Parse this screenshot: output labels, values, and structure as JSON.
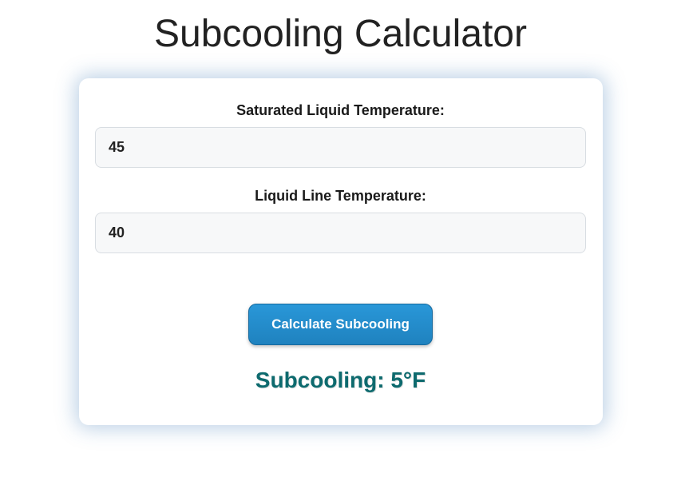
{
  "title": "Subcooling Calculator",
  "fields": {
    "sat_liquid": {
      "label": "Saturated Liquid Temperature:",
      "value": "45"
    },
    "liquid_line": {
      "label": "Liquid Line Temperature:",
      "value": "40"
    }
  },
  "button": {
    "calculate_label": "Calculate Subcooling"
  },
  "result": {
    "text": "Subcooling: 5°F"
  }
}
